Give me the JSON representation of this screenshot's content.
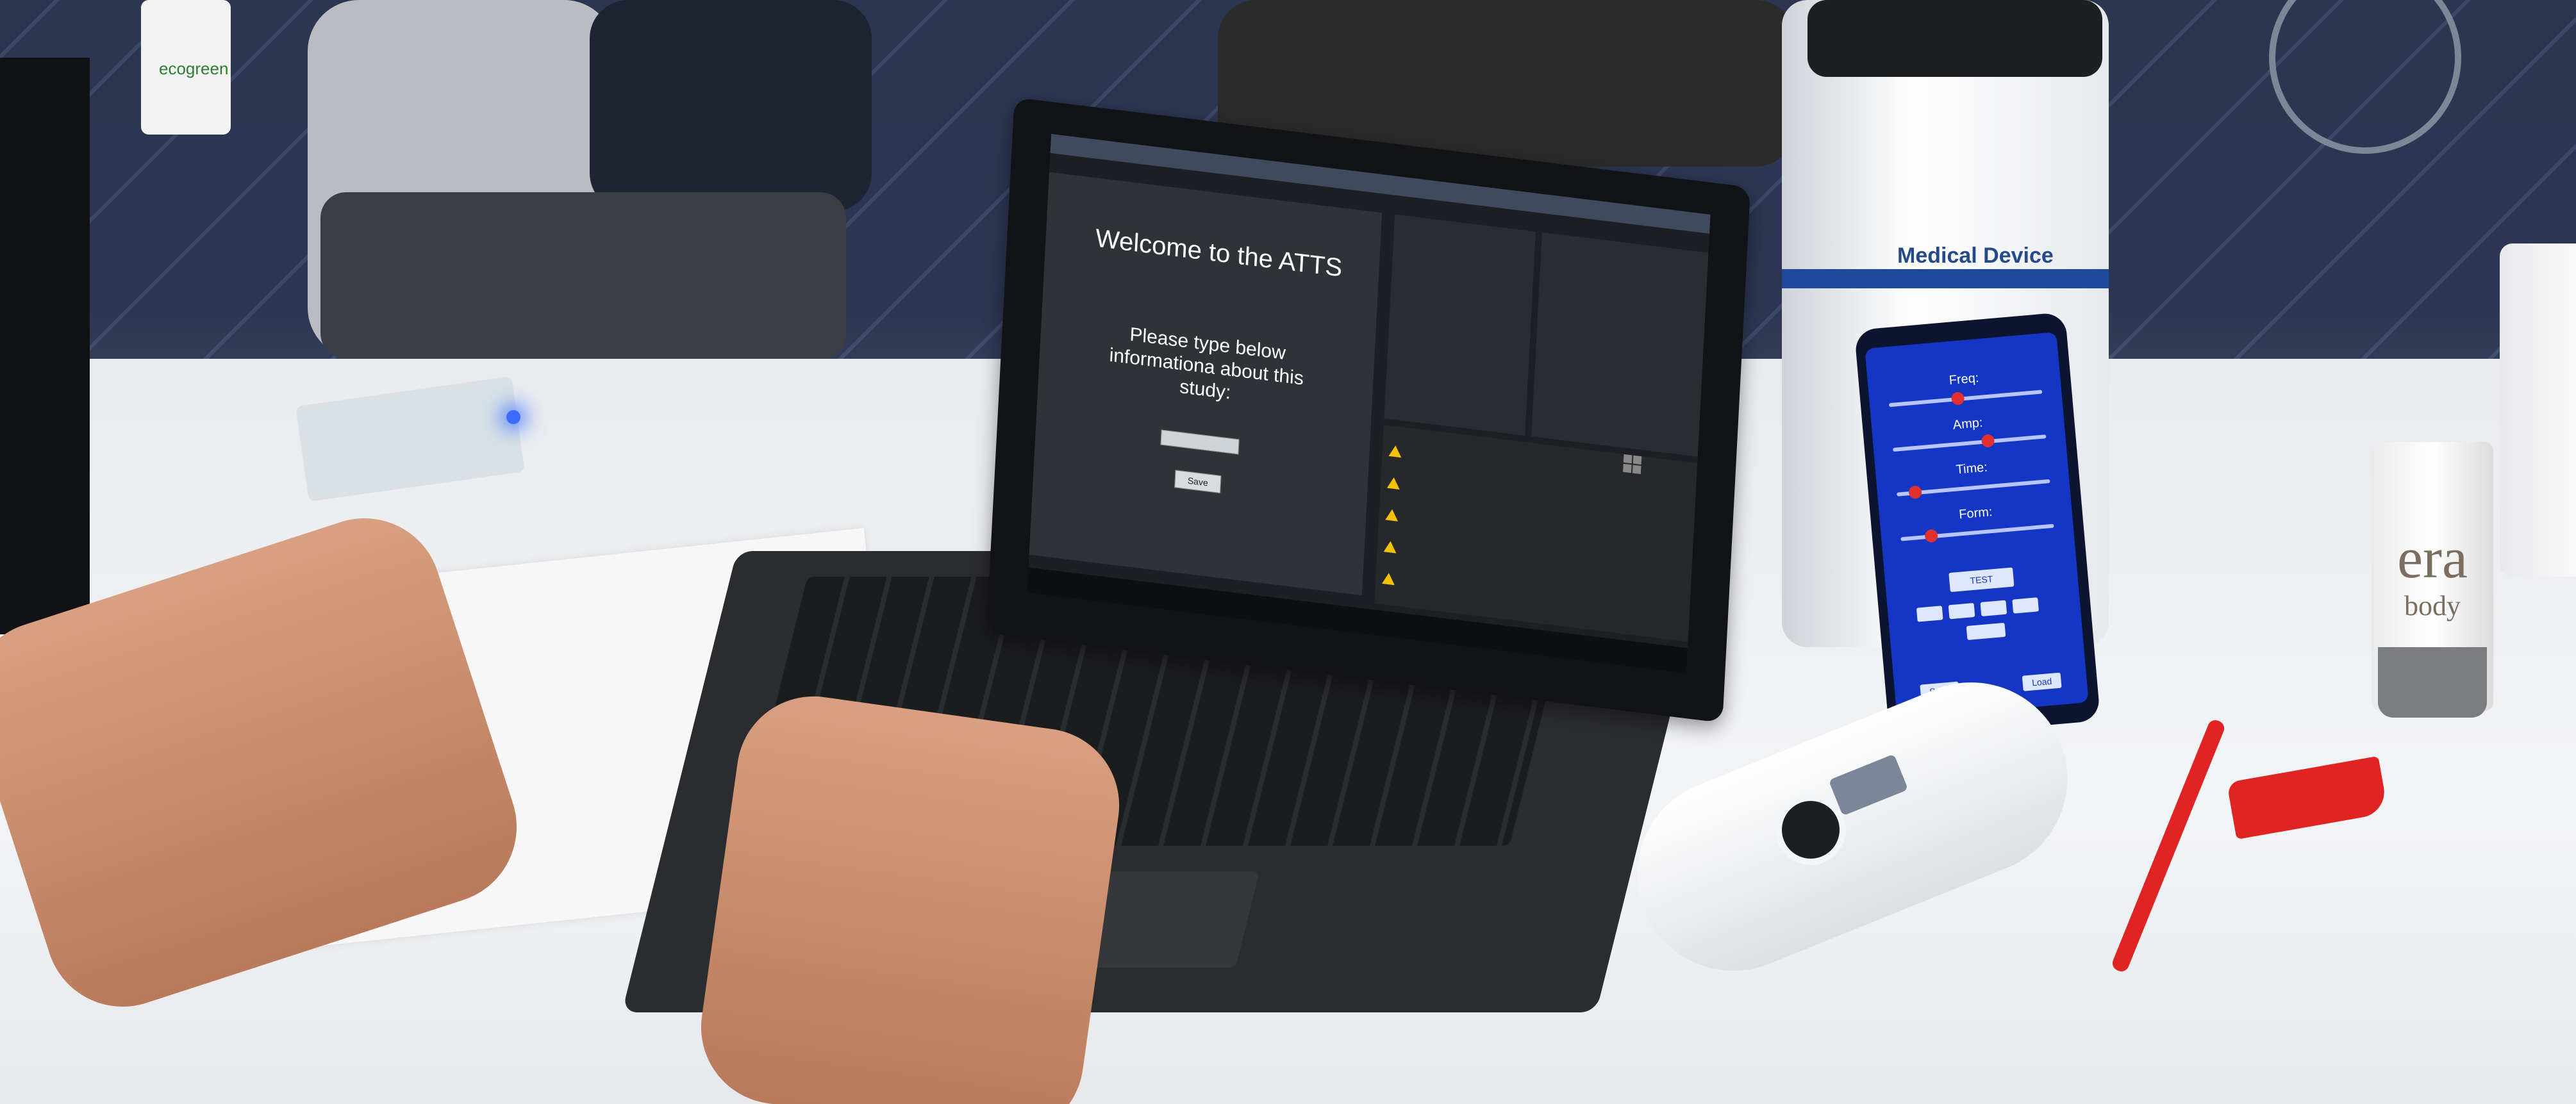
{
  "scene": {
    "description_type": "photo",
    "colors": {
      "phone_screen": "#1436c4",
      "slider_knob": "#e03030",
      "pen": "#e02424",
      "led": "#3b6cff"
    }
  },
  "laptop_app": {
    "welcome_title": "Welcome to the ATTS",
    "prompt_text": "Please type below informationa about this study:",
    "submit_label": "Save"
  },
  "phone_app": {
    "sliders": [
      {
        "label": "Freq:",
        "level": 0.45
      },
      {
        "label": "Amp:",
        "level": 0.62
      },
      {
        "label": "Time:",
        "level": 0.12
      },
      {
        "label": "Form:",
        "level": 0.2
      }
    ],
    "test_label": "TEST",
    "save_label": "Save",
    "load_label": "Load"
  },
  "canister": {
    "label_text": "Medical Device"
  },
  "tube": {
    "brand": "era",
    "sub": "body"
  },
  "bag": {
    "label": "ecogreen"
  }
}
